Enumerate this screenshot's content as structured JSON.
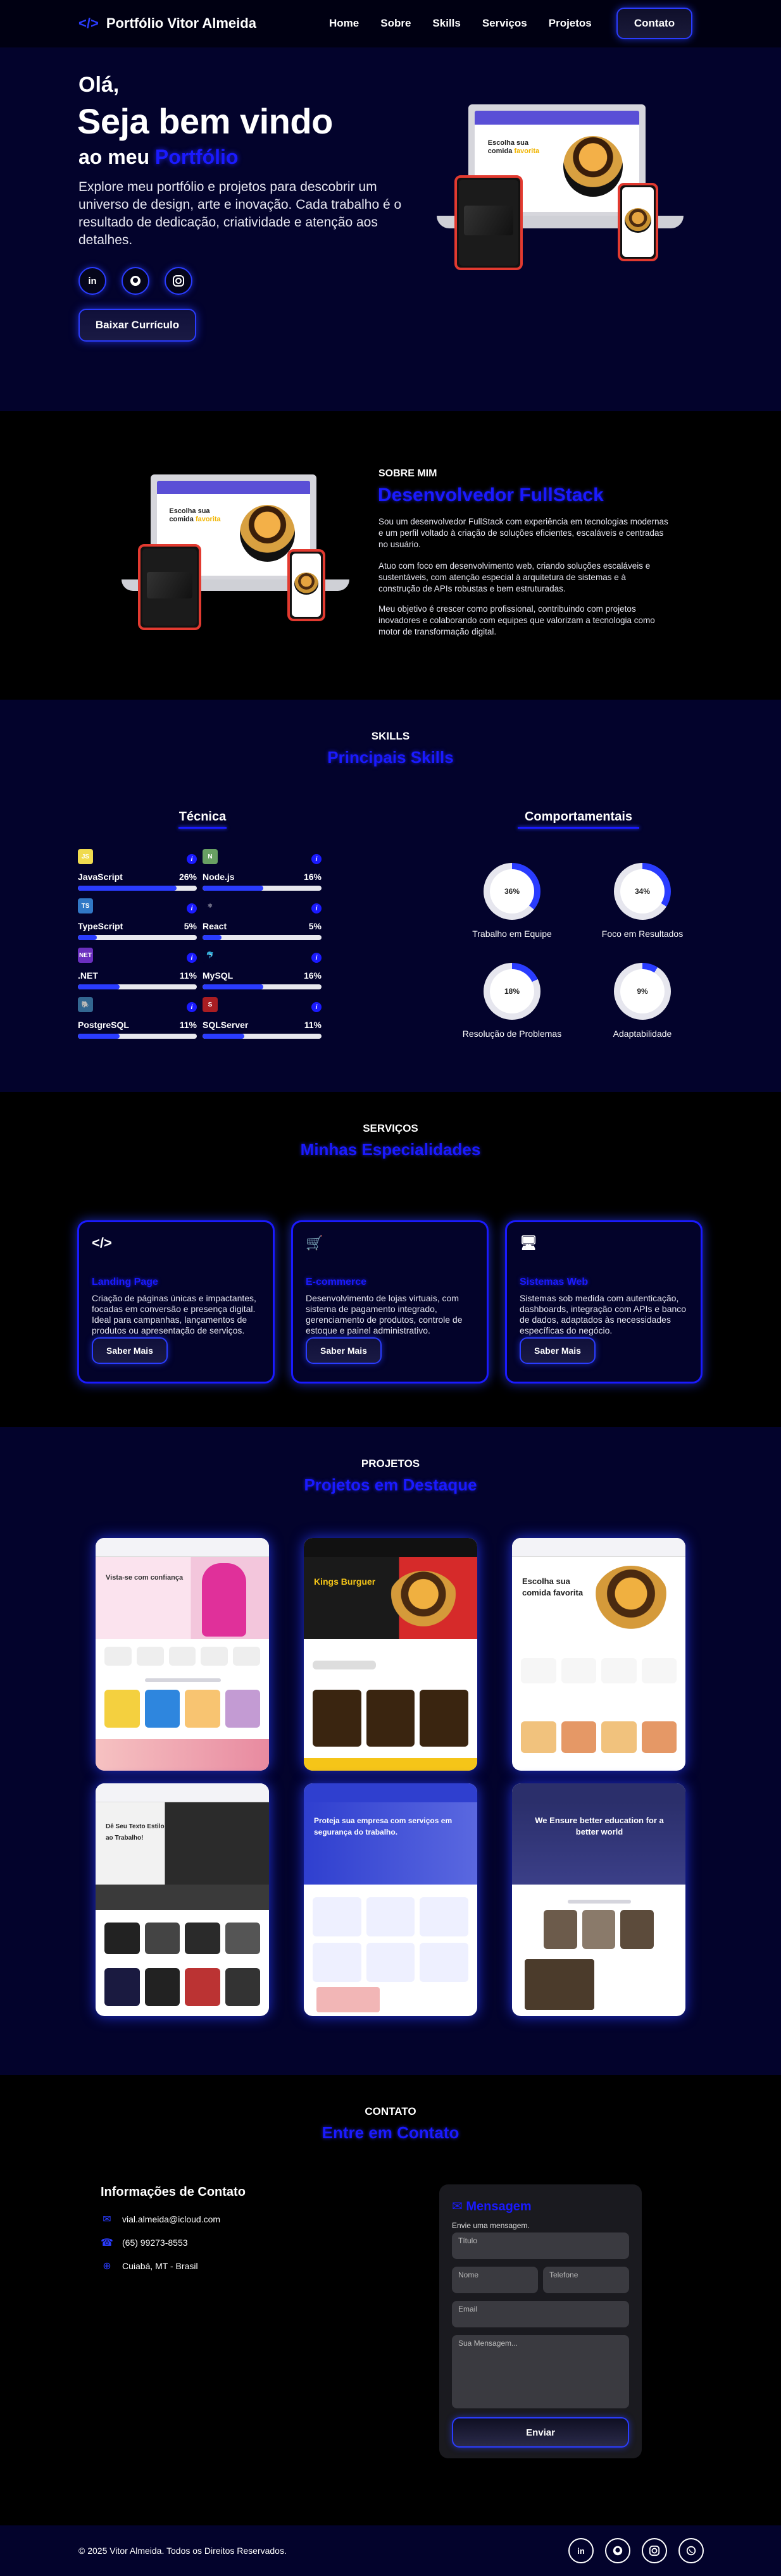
{
  "nav": {
    "brand_icon": "</>",
    "brand": "Portfólio Vitor Almeida",
    "links": [
      "Home",
      "Sobre",
      "Skills",
      "Serviços",
      "Projetos"
    ],
    "contact": "Contato"
  },
  "hero": {
    "hi": "Olá,",
    "welcome": "Seja bem vindo",
    "my_prefix": "ao meu",
    "my_highlight": "Portfólio",
    "desc": "Explore meu portfólio e projetos para descobrir um universo de design, arte e inovação. Cada trabalho é o resultado de dedicação, criatividade e atenção aos detalhes.",
    "socials": [
      "linkedin-icon",
      "github-icon",
      "instagram-icon"
    ],
    "cv_button": "Baixar Currículo",
    "mock_text_a": "Escolha sua comida",
    "mock_text_b": "favorita"
  },
  "about": {
    "kicker": "SOBRE MIM",
    "title": "Desenvolvedor FullStack",
    "paragraphs": [
      "Sou um desenvolvedor FullStack com experiência em tecnologias modernas e um perfil voltado à criação de soluções eficientes, escaláveis e centradas no usuário.",
      "Atuo com foco em desenvolvimento web, criando soluções escaláveis e sustentáveis, com atenção especial à arquitetura de sistemas e à construção de APIs robustas e bem estruturadas.",
      "Meu objetivo é crescer como profissional, contribuindo com projetos inovadores e colaborando com equipes que valorizam a tecnologia como motor de transformação digital."
    ]
  },
  "skills": {
    "kicker": "SKILLS",
    "title": "Principais Skills",
    "tech_head": "Técnica",
    "soft_head": "Comportamentais",
    "tech": [
      {
        "name": "JavaScript",
        "pct": "26%",
        "value": 26,
        "logo": "JS",
        "color": "#f0db4f"
      },
      {
        "name": "Node.js",
        "pct": "16%",
        "value": 16,
        "logo": "N",
        "color": "#68a063"
      },
      {
        "name": "TypeScript",
        "pct": "5%",
        "value": 5,
        "logo": "TS",
        "color": "#3178c6"
      },
      {
        "name": "React",
        "pct": "5%",
        "value": 5,
        "logo": "⚛",
        "color": "#03032c"
      },
      {
        "name": ".NET",
        "pct": "11%",
        "value": 11,
        "logo": "NET",
        "color": "#6b2fbf"
      },
      {
        "name": "MySQL",
        "pct": "16%",
        "value": 16,
        "logo": "🐬",
        "color": "#03032c"
      },
      {
        "name": "PostgreSQL",
        "pct": "11%",
        "value": 11,
        "logo": "🐘",
        "color": "#336791"
      },
      {
        "name": "SQLServer",
        "pct": "11%",
        "value": 11,
        "logo": "S",
        "color": "#a91d22"
      }
    ],
    "soft": [
      {
        "label": "Trabalho em Equipe",
        "pct": "36%",
        "value": 36
      },
      {
        "label": "Foco em Resultados",
        "pct": "34%",
        "value": 34
      },
      {
        "label": "Resolução de Problemas",
        "pct": "18%",
        "value": 18
      },
      {
        "label": "Adaptabilidade",
        "pct": "9%",
        "value": 9
      }
    ],
    "info_glyph": "i"
  },
  "services": {
    "kicker": "SERVIÇOS",
    "title": "Minhas Especialidades",
    "cards": [
      {
        "icon": "</>",
        "title": "Landing Page",
        "desc": "Criação de páginas únicas e impactantes, focadas em conversão e presença digital. Ideal para campanhas, lançamentos de produtos ou apresentação de serviços.",
        "button": "Saber Mais"
      },
      {
        "icon": "🛒",
        "title": "E-commerce",
        "desc": "Desenvolvimento de lojas virtuais, com sistema de pagamento integrado, gerenciamento de produtos, controle de estoque e painel administrativo.",
        "button": "Saber Mais"
      },
      {
        "icon": "🖥",
        "title": "Sistemas Web",
        "desc": "Sistemas sob medida com autenticação, dashboards, integração com APIs e banco de dados, adaptados às necessidades específicas do negócio.",
        "button": "Saber Mais"
      }
    ]
  },
  "projects": {
    "kicker": "PROJETOS",
    "title": "Projetos em Destaque",
    "items": [
      {
        "caption": "Vista-se com confiança",
        "theme": "fashion"
      },
      {
        "caption": "Kings Burguer",
        "theme": "burger"
      },
      {
        "caption": "Escolha sua comida favorita",
        "theme": "food"
      },
      {
        "caption": "Dê Seu Texto Estilo ao Trabalho!",
        "theme": "tech"
      },
      {
        "caption": "Proteja sua empresa com serviços em segurança do trabalho.",
        "theme": "safety"
      },
      {
        "caption": "We Ensure better education for a better world",
        "theme": "edu"
      }
    ]
  },
  "contact": {
    "kicker": "CONTATO",
    "title": "Entre em Contato",
    "info_title": "Informações de Contato",
    "email": "vial.almeida@icloud.com",
    "phone": "(65) 99273-8553",
    "location": "Cuiabá, MT - Brasil",
    "form_title": "Mensagem",
    "form_sub": "Envie uma mensagem.",
    "ph_title": "Título",
    "ph_name": "Nome",
    "ph_phone": "Telefone",
    "ph_email": "Email",
    "ph_msg": "Sua Mensagem...",
    "send": "Enviar"
  },
  "footer": {
    "copy": "© 2025 Vitor Almeida. Todos os Direitos Reservados.",
    "socials": [
      "linkedin-icon",
      "github-icon",
      "instagram-icon",
      "whatsapp-icon"
    ]
  }
}
